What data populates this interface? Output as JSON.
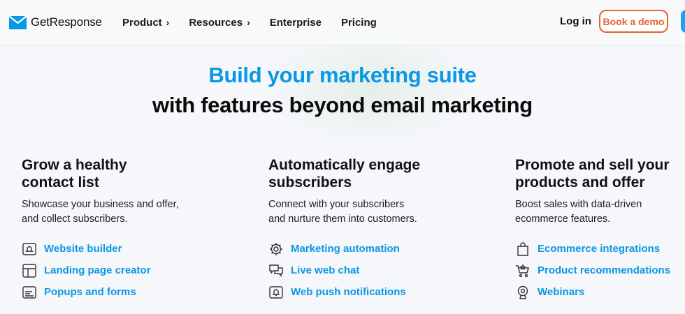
{
  "header": {
    "logo_text": "GetResponse",
    "nav": [
      {
        "label": "Product",
        "has_chevron": true
      },
      {
        "label": "Resources",
        "has_chevron": true
      },
      {
        "label": "Enterprise",
        "has_chevron": false
      },
      {
        "label": "Pricing",
        "has_chevron": false
      }
    ],
    "chevron": "›",
    "login_label": "Log in",
    "demo_label": "Book a demo"
  },
  "hero": {
    "line1": "Build your marketing suite",
    "line2": "with features beyond email marketing"
  },
  "columns": [
    {
      "title": "Grow a healthy\ncontact list",
      "desc": "Showcase your business and offer,\nand collect subscribers.",
      "links": [
        {
          "label": "Website builder",
          "icon": "website-builder-icon"
        },
        {
          "label": "Landing page creator",
          "icon": "landing-page-icon"
        },
        {
          "label": "Popups and forms",
          "icon": "popup-form-icon"
        }
      ]
    },
    {
      "title": "Automatically engage\nsubscribers",
      "desc": "Connect with your subscribers\nand nurture them into customers.",
      "links": [
        {
          "label": "Marketing automation",
          "icon": "gear-icon"
        },
        {
          "label": "Live web chat",
          "icon": "chat-icon"
        },
        {
          "label": "Web push notifications",
          "icon": "bell-icon"
        }
      ]
    },
    {
      "title": "Promote and sell your\nproducts and offer",
      "desc": "Boost sales with data-driven\necommerce features.",
      "links": [
        {
          "label": "Ecommerce integrations",
          "icon": "shopping-bag-icon"
        },
        {
          "label": "Product recommendations",
          "icon": "cart-icon"
        },
        {
          "label": "Webinars",
          "icon": "webcam-icon"
        }
      ]
    }
  ],
  "colors": {
    "brand_blue": "#0a97e6",
    "demo_orange": "#e0652f",
    "text_dark": "#111111"
  }
}
